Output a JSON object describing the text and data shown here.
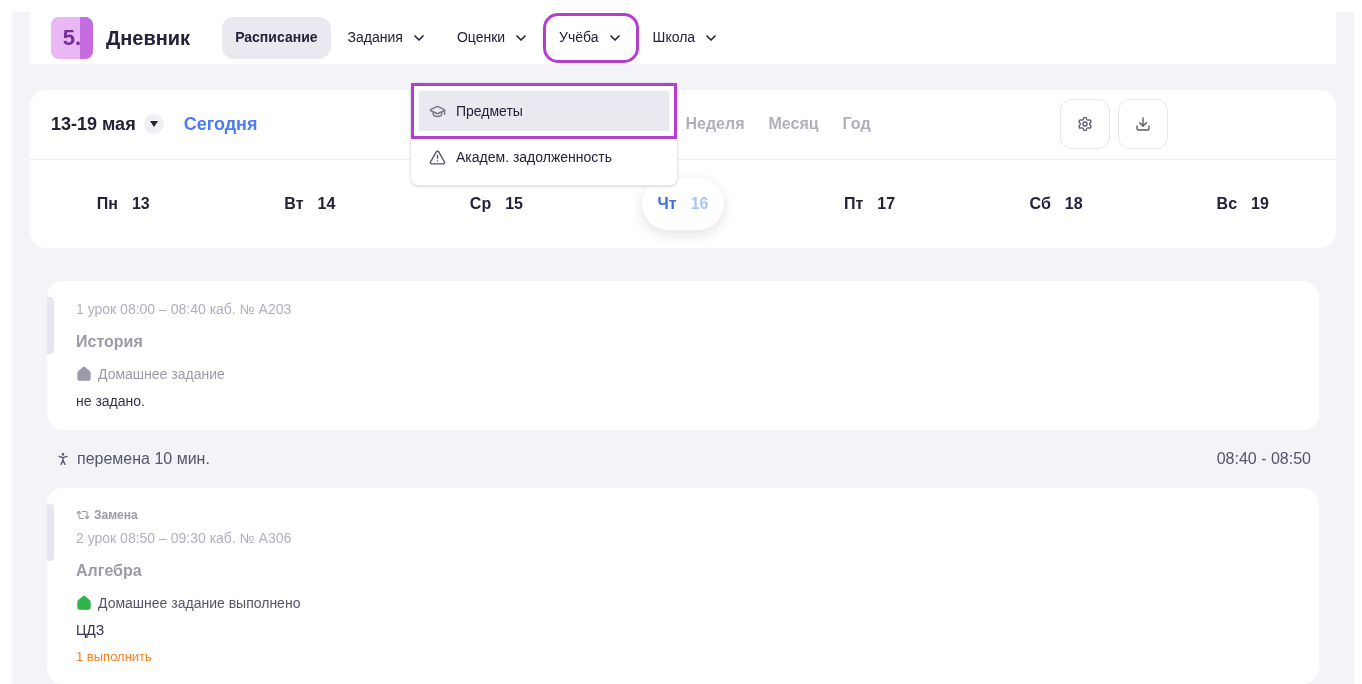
{
  "app": {
    "logo_text": "5.",
    "title": "Дневник"
  },
  "nav": [
    {
      "label": "Расписание",
      "selected": true,
      "has_menu": false,
      "highlighted": false
    },
    {
      "label": "Задания",
      "selected": false,
      "has_menu": true,
      "highlighted": false
    },
    {
      "label": "Оценки",
      "selected": false,
      "has_menu": true,
      "highlighted": false
    },
    {
      "label": "Учёба",
      "selected": false,
      "has_menu": true,
      "highlighted": true
    },
    {
      "label": "Школа",
      "selected": false,
      "has_menu": true,
      "highlighted": false
    }
  ],
  "dropdown": [
    {
      "label": "Предметы",
      "selected": true,
      "highlighted": true
    },
    {
      "label": "Академ. задолженность",
      "selected": false,
      "highlighted": false
    }
  ],
  "week": {
    "range": "13-19 мая",
    "today_link": "Сегодня"
  },
  "views": [
    {
      "label": "Неделя",
      "selected": false
    },
    {
      "label": "Месяц",
      "selected": false
    },
    {
      "label": "Год",
      "selected": false
    }
  ],
  "days": [
    {
      "name": "Пн",
      "date": "13",
      "selected": false
    },
    {
      "name": "Вт",
      "date": "14",
      "selected": false
    },
    {
      "name": "Ср",
      "date": "15",
      "selected": false
    },
    {
      "name": "Чт",
      "date": "16",
      "selected": true
    },
    {
      "name": "Пт",
      "date": "17",
      "selected": false
    },
    {
      "name": "Сб",
      "date": "18",
      "selected": false
    },
    {
      "name": "Вс",
      "date": "19",
      "selected": false
    }
  ],
  "schedule": [
    {
      "kind": "lesson",
      "time": "1 урок 08:00 – 08:40 каб. № А203",
      "subject": "История",
      "homework_status": "Домашнее задание",
      "homework_done": false,
      "homework": "не задано."
    },
    {
      "kind": "break",
      "label": "перемена 10 мин.",
      "time": "08:40 - 08:50"
    },
    {
      "kind": "lesson",
      "replacement": "Замена",
      "time": "2 урок 08:50 – 09:30 каб. № А306",
      "subject": "Алгебра",
      "homework_status": "Домашнее задание выполнено",
      "homework_done": true,
      "homework": "ЦДЗ",
      "todo": "1 выполнить"
    }
  ]
}
